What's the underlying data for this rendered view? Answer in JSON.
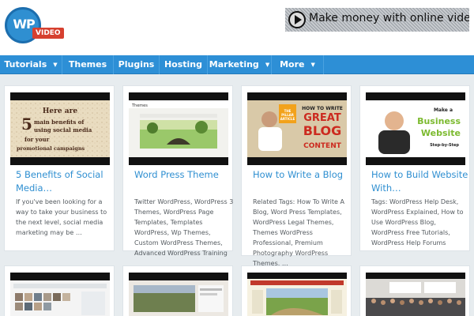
{
  "site": {
    "logo_text": "WP",
    "logo_badge": "VIDEO",
    "ad_text": "Make money with online video"
  },
  "nav": {
    "items": [
      {
        "label": "Tutorials",
        "has_dropdown": true
      },
      {
        "label": "Themes",
        "has_dropdown": false
      },
      {
        "label": "Plugins",
        "has_dropdown": false
      },
      {
        "label": "Hosting",
        "has_dropdown": false
      },
      {
        "label": "Marketing",
        "has_dropdown": true
      },
      {
        "label": "More",
        "has_dropdown": true
      }
    ]
  },
  "posts": [
    {
      "title": "5 Benefits of Social Media…",
      "excerpt": "If you've been looking for a way to take your business to the next level, social media marketing may be …",
      "thumb_text": "Here are 5 main benefits of using social media for your promotional campaigns"
    },
    {
      "title": "Word Press Theme",
      "excerpt": "Twitter WordPress, WordPress 3 Themes, WordPress Page Templates, Templates WordPress, Wp Themes, Custom WordPress Themes, Advanced WordPress Training",
      "thumb_text": "Themes"
    },
    {
      "title": "How to Write a Blog",
      "excerpt": "Related Tags: How To Write A Blog, Word Press Templates, WordPress Legal Themes, Themes WordPress Professional, Premium Photography WordPress Themes, …",
      "thumb_text": "HOW TO WRITE GREAT BLOG CONTENT",
      "thumb_badge": "THE PILLAR ARTICLE"
    },
    {
      "title": "How to Build Website With…",
      "excerpt": "Tags: WordPress Help Desk, WordPress Explained, How to Use WordPress Blog, WordPress Free Tutorials, WordPress Help Forums",
      "thumb_text": "Business Website",
      "thumb_pre": "Make a",
      "thumb_post": "Step-by-Step"
    }
  ],
  "colors": {
    "accent": "#2d8fd6",
    "title_link": "#2f8fd1",
    "logo_badge": "#d6402f",
    "page_bg": "#e7ecef"
  }
}
